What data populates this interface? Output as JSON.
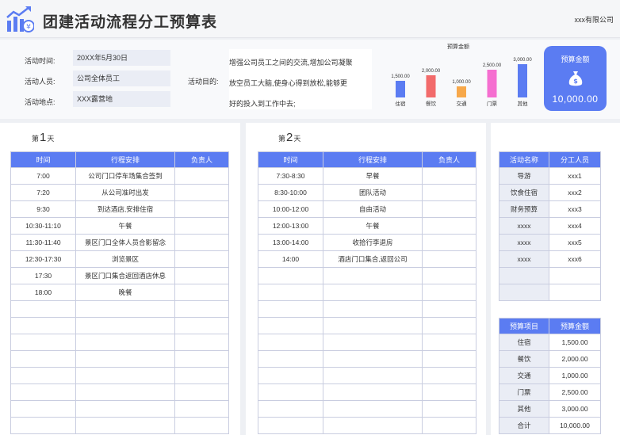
{
  "header": {
    "title": "团建活动流程分工预算表",
    "company": "xxx有限公司"
  },
  "info": {
    "time_label": "活动时间:",
    "time_value": "20XX年5月30日",
    "people_label": "活动人员:",
    "people_value": "公司全体员工",
    "place_label": "活动地点:",
    "place_value": "XXX露营地",
    "purpose_label": "活动目的:",
    "purpose_lines": [
      "增强公司员工之间的交流,增加公司凝聚",
      "放空员工大脑,使身心得到放松,能够更",
      "好的投入到工作中去;"
    ]
  },
  "chart_data": {
    "type": "bar",
    "title": "预算金额",
    "categories": [
      "住宿",
      "餐饮",
      "交通",
      "门票",
      "其他"
    ],
    "values": [
      1500,
      2000,
      1000,
      2500,
      3000
    ],
    "value_labels": [
      "1,500.00",
      "2,000.00",
      "1,000.00",
      "2,500.00",
      "3,000.00"
    ],
    "colors": [
      "#5b7cf2",
      "#f26b6b",
      "#f7a84a",
      "#f56fd0",
      "#5b7cf2"
    ],
    "ylim": [
      0,
      3000
    ]
  },
  "total": {
    "title": "预算金额",
    "icon": "money-bag-icon",
    "amount": "10,000.00"
  },
  "day1": {
    "prefix": "第",
    "num": "1",
    "suffix": "天",
    "headers": [
      "时间",
      "行程安排",
      "负责人"
    ],
    "rows": [
      [
        "7:00",
        "公司门口停车场集合签到",
        ""
      ],
      [
        "7:20",
        "从公司准时出发",
        ""
      ],
      [
        "9:30",
        "到达酒店,安排住宿",
        ""
      ],
      [
        "10:30-11:10",
        "午餐",
        ""
      ],
      [
        "11:30-11:40",
        "景区门口全体人员合影留念",
        ""
      ],
      [
        "12:30-17:30",
        "浏览景区",
        ""
      ],
      [
        "17:30",
        "景区门口集合返回酒店休息",
        ""
      ],
      [
        "18:00",
        "晚餐",
        ""
      ],
      [
        "",
        "",
        ""
      ],
      [
        "",
        "",
        ""
      ],
      [
        "",
        "",
        ""
      ],
      [
        "",
        "",
        ""
      ],
      [
        "",
        "",
        ""
      ],
      [
        "",
        "",
        ""
      ],
      [
        "",
        "",
        ""
      ],
      [
        "",
        "",
        ""
      ]
    ]
  },
  "day2": {
    "prefix": "第",
    "num": "2",
    "suffix": "天",
    "headers": [
      "时间",
      "行程安排",
      "负责人"
    ],
    "rows": [
      [
        "7:30-8:30",
        "早餐",
        ""
      ],
      [
        "8:30-10:00",
        "团队活动",
        ""
      ],
      [
        "10:00-12:00",
        "自由活动",
        ""
      ],
      [
        "12:00-13:00",
        "午餐",
        ""
      ],
      [
        "13:00-14:00",
        "收拾行李退房",
        ""
      ],
      [
        "14:00",
        "酒店门口集合,返回公司",
        ""
      ],
      [
        "",
        "",
        ""
      ],
      [
        "",
        "",
        ""
      ],
      [
        "",
        "",
        ""
      ],
      [
        "",
        "",
        ""
      ],
      [
        "",
        "",
        ""
      ],
      [
        "",
        "",
        ""
      ],
      [
        "",
        "",
        ""
      ],
      [
        "",
        "",
        ""
      ],
      [
        "",
        "",
        ""
      ],
      [
        "",
        "",
        ""
      ]
    ]
  },
  "roles": {
    "headers": [
      "活动名称",
      "分工人员"
    ],
    "rows": [
      [
        "导游",
        "xxx1"
      ],
      [
        "饮食住宿",
        "xxx2"
      ],
      [
        "财务预算",
        "xxx3"
      ],
      [
        "xxxx",
        "xxx4"
      ],
      [
        "xxxx",
        "xxx5"
      ],
      [
        "xxxx",
        "xxx6"
      ],
      [
        "",
        ""
      ],
      [
        "",
        ""
      ]
    ]
  },
  "budget": {
    "headers": [
      "预算项目",
      "预算金额"
    ],
    "rows": [
      [
        "住宿",
        "1,500.00"
      ],
      [
        "餐饮",
        "2,000.00"
      ],
      [
        "交通",
        "1,000.00"
      ],
      [
        "门票",
        "2,500.00"
      ],
      [
        "其他",
        "3,000.00"
      ],
      [
        "合计",
        "10,000.00"
      ]
    ]
  }
}
